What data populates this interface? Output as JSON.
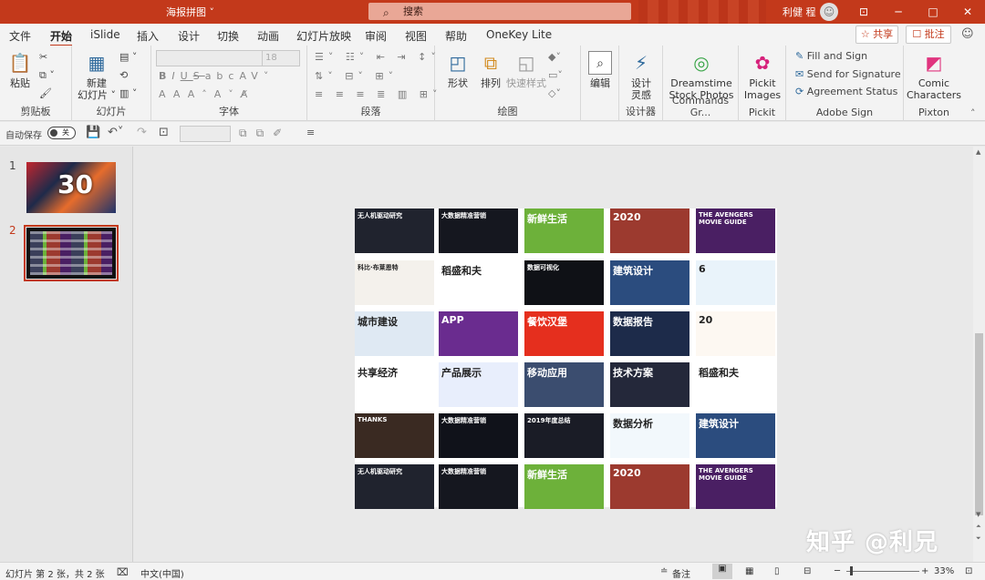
{
  "titlebar": {
    "doc_title": "海报拼图 ˅",
    "search_placeholder": "搜索",
    "user_name": "利健 程",
    "minimize": "─",
    "restore": "□",
    "close": "✕",
    "ribbon_display": "⊡"
  },
  "tabs": [
    "文件",
    "开始",
    "iSlide",
    "插入",
    "设计",
    "切换",
    "动画",
    "幻灯片放映",
    "审阅",
    "视图",
    "帮助",
    "OneKey Lite"
  ],
  "active_tab": "开始",
  "share_label": "☆ 共享",
  "comment_label": "☐ 批注",
  "ribbon": {
    "clipboard": {
      "paste": "粘贴",
      "group": "剪贴板"
    },
    "slides": {
      "new_slide": "新建\n幻灯片 ˅",
      "group": "幻灯片"
    },
    "font": {
      "size": "18",
      "group": "字体",
      "bold": "B",
      "italic": "I",
      "underline": "U",
      "strike": "S",
      "shadow": "abc",
      "spacing": "AV˅",
      "grow": "A˄",
      "shrink": "A˅",
      "clear": "A̸",
      "fill": "A",
      "color": "A"
    },
    "paragraph": {
      "group": "段落"
    },
    "drawing": {
      "shapes": "形状",
      "arrange": "排列",
      "quick_styles": "快速样式",
      "group": "绘图"
    },
    "editing": {
      "edit": "编辑"
    },
    "designer": {
      "label": "设计\n灵感",
      "group": "设计器"
    },
    "dreamstime": {
      "label": "Dreamstime\nStock Photos",
      "group": "Commands Gr..."
    },
    "pickit": {
      "label": "Pickit\nImages",
      "group": "Pickit"
    },
    "adobe_sign": {
      "fill_sign": "Fill and Sign",
      "send_sig": "Send for Signature",
      "agreement": "Agreement Status",
      "group": "Adobe Sign"
    },
    "pixton": {
      "label": "Comic\nCharacters",
      "group": "Pixton"
    }
  },
  "qat": {
    "autosave": "自动保存",
    "toggle": "关"
  },
  "slides_pane": {
    "numbers": [
      "1",
      "2"
    ],
    "slide1_text": "30"
  },
  "slide_cells": [
    {
      "bg": "#20232e",
      "text": "无人机驱动研究"
    },
    {
      "bg": "#15171f",
      "text": "大数据精准营销"
    },
    {
      "bg": "#6db13a",
      "text": "新鲜生活"
    },
    {
      "bg": "#9c3a2f",
      "text": "2020"
    },
    {
      "bg": "#4a1f63",
      "text": "THE AVENGERS MOVIE GUIDE"
    },
    {
      "bg": "#f4f1ec",
      "text": "科比·布莱恩特"
    },
    {
      "bg": "#ffffff",
      "text": "稻盛和夫"
    },
    {
      "bg": "#0f1116",
      "text": "数据可视化"
    },
    {
      "bg": "#2b4c7e",
      "text": "建筑设计"
    },
    {
      "bg": "#e9f3fa",
      "text": "6"
    },
    {
      "bg": "#dfe9f3",
      "text": "城市建设"
    },
    {
      "bg": "#6a2c8f",
      "text": "APP"
    },
    {
      "bg": "#e52f1e",
      "text": "餐饮汉堡"
    },
    {
      "bg": "#1d2b4a",
      "text": "数据报告"
    },
    {
      "bg": "#fdf8f2",
      "text": "20"
    },
    {
      "bg": "#ffffff",
      "text": "共享经济"
    },
    {
      "bg": "#e8eefc",
      "text": "产品展示"
    },
    {
      "bg": "#3b4d6f",
      "text": "移动应用"
    },
    {
      "bg": "#24283a",
      "text": "技术方案"
    },
    {
      "bg": "#ffffff",
      "text": "稻盛和夫"
    },
    {
      "bg": "#3a2a22",
      "text": "THANKS"
    },
    {
      "bg": "#10121a",
      "text": "大数据精准营销"
    },
    {
      "bg": "#1a1c26",
      "text": "2019年度总结"
    },
    {
      "bg": "#f2f8fc",
      "text": "数据分析"
    },
    {
      "bg": "#2b4c7e",
      "text": "建筑设计"
    },
    {
      "bg": "#20232e",
      "text": "无人机驱动研究"
    },
    {
      "bg": "#15171f",
      "text": "大数据精准营销"
    },
    {
      "bg": "#6db13a",
      "text": "新鲜生活"
    },
    {
      "bg": "#9c3a2f",
      "text": "2020"
    },
    {
      "bg": "#4a1f63",
      "text": "THE AVENGERS MOVIE GUIDE"
    }
  ],
  "watermark": "知乎 @利兄",
  "status": {
    "slide_info": "幻灯片 第 2 张，共 2 张",
    "language": "中文(中国)",
    "notes": "备注",
    "zoom": "33%"
  }
}
